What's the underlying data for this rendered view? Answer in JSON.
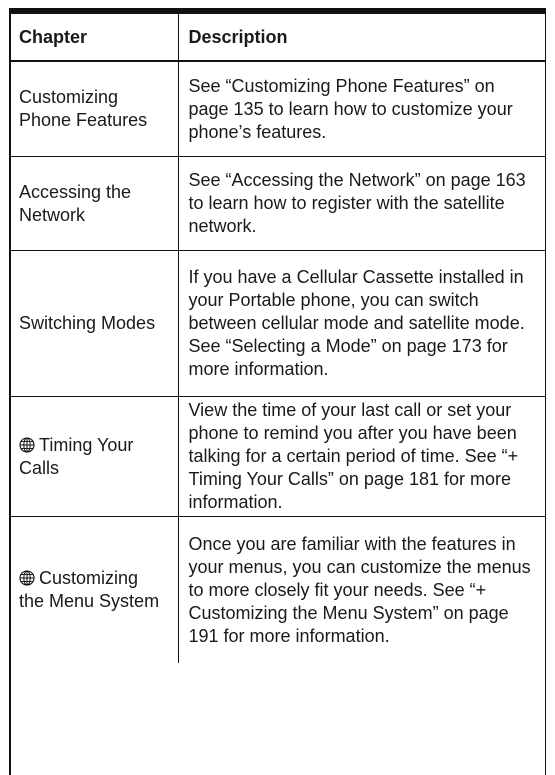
{
  "table": {
    "headers": [
      "Chapter",
      "Description"
    ],
    "rows": [
      {
        "chapter": "Customizing Phone Features",
        "has_icon": false,
        "description": "See “Customizing Phone Features” on page 135 to learn how to customize your phone’s features."
      },
      {
        "chapter": "Accessing the Network",
        "has_icon": false,
        "description": "See “Accessing the Network” on page 163 to learn how to register with the satellite network."
      },
      {
        "chapter": "Switching Modes",
        "has_icon": false,
        "description": "If you have a Cellular Cassette installed in your Portable phone, you can switch between cellular mode and satellite mode. See “Selecting a Mode” on page 173 for more information."
      },
      {
        "chapter": "Timing Your Calls",
        "has_icon": true,
        "description": "View the time of your last call or set your phone to remind you after you have been talking for a certain period of time. See “+ Timing Your Calls” on page 181 for more information."
      },
      {
        "chapter": "Customizing the Menu System",
        "has_icon": true,
        "description": "Once you are familiar with the features in your menus, you can customize the menus to more closely fit your needs. See “+ Customizing the Menu System” on page 191 for more information."
      }
    ]
  },
  "icons": {
    "row_marker": "globe-icon"
  }
}
